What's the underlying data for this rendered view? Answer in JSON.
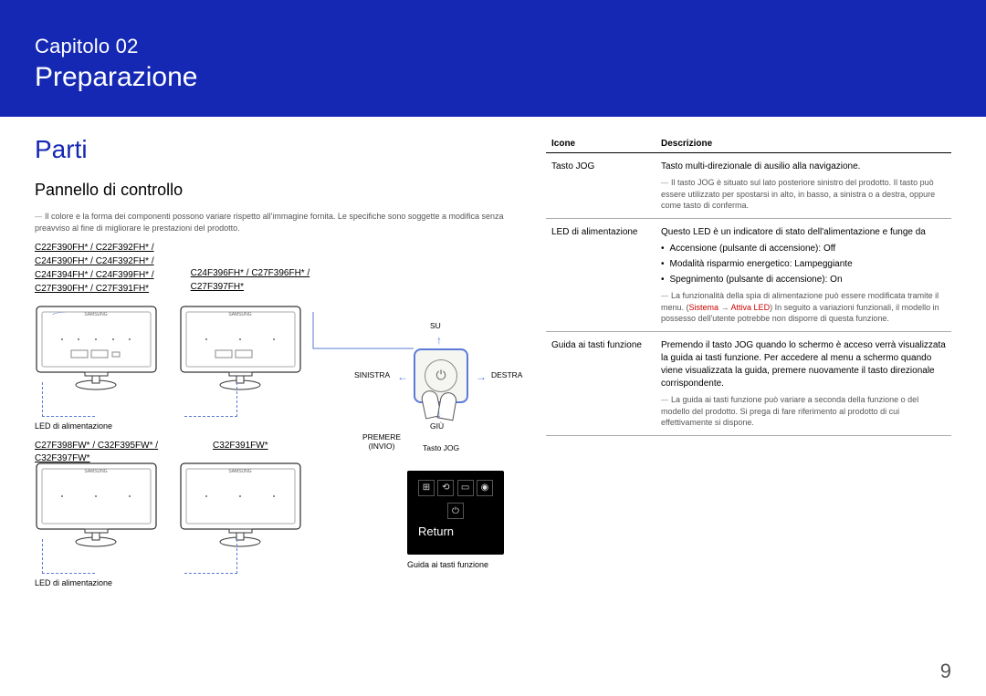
{
  "header": {
    "chapter_label": "Capitolo 02",
    "chapter_title": "Preparazione"
  },
  "section_title": "Parti",
  "subsection_title": "Pannello di controllo",
  "intro_note": "Il colore e la forma dei componenti possono variare rispetto all'immagine fornita. Le specifiche sono soggette a modifica senza preavviso al fine di migliorare le prestazioni del prodotto.",
  "models_top": {
    "col1": [
      "C22F390FH* / C22F392FH* /",
      "C24F390FH* / C24F392FH* /",
      "C24F394FH* / C24F399FH* /",
      "C27F390FH* / C27F391FH*"
    ],
    "col2": [
      "C24F396FH* / C27F396FH* /",
      "C27F397FH*"
    ]
  },
  "led_label": "LED di alimentazione",
  "models_mid": {
    "col1": "C27F398FW* / C32F395FW* /\nC32F397FW*",
    "col2": "C32F391FW*"
  },
  "jog": {
    "su": "SU",
    "giu": "GIÙ",
    "sinistra": "SINISTRA",
    "destra": "DESTRA",
    "premere": "PREMERE (INVIO)",
    "tasto_jog": "Tasto JOG"
  },
  "return_box": {
    "label": "Return"
  },
  "guide_label": "Guida ai tasti funzione",
  "table": {
    "h_icone": "Icone",
    "h_desc": "Descrizione",
    "rows": [
      {
        "icon": "Tasto JOG",
        "desc": "Tasto multi-direzionale di ausilio alla navigazione.",
        "note": "Il tasto JOG è situato sul lato posteriore sinistro del prodotto. Il tasto può essere utilizzato per spostarsi in alto, in basso, a sinistra o a destra, oppure come tasto di conferma."
      },
      {
        "icon": "LED di alimentazione",
        "desc": "Questo LED è un indicatore di stato dell'alimentazione e funge da",
        "bullets": [
          "Accensione (pulsante di accensione): Off",
          "Modalità risparmio energetico: Lampeggiante",
          "Spegnimento (pulsante di accensione): On"
        ],
        "note_pre": "La funzionalità della spia di alimentazione può essere modificata tramite il menu. (",
        "note_red1": "Sistema",
        "note_arrow": " → ",
        "note_red2": "Attiva LED",
        "note_post": ") In seguito a variazioni funzionali, il modello in possesso dell'utente potrebbe non disporre di questa funzione."
      },
      {
        "icon": "Guida ai tasti funzione",
        "desc": "Premendo il tasto JOG quando lo schermo è acceso verrà visualizzata la guida ai tasti funzione. Per accedere al menu a schermo quando viene visualizzata la guida, premere nuovamente il tasto direzionale corrispondente.",
        "note": "La guida ai tasti funzione può variare a seconda della funzione o del modello del prodotto. Si prega di fare riferimento al prodotto di cui effettivamente si dispone."
      }
    ]
  },
  "page_number": "9"
}
